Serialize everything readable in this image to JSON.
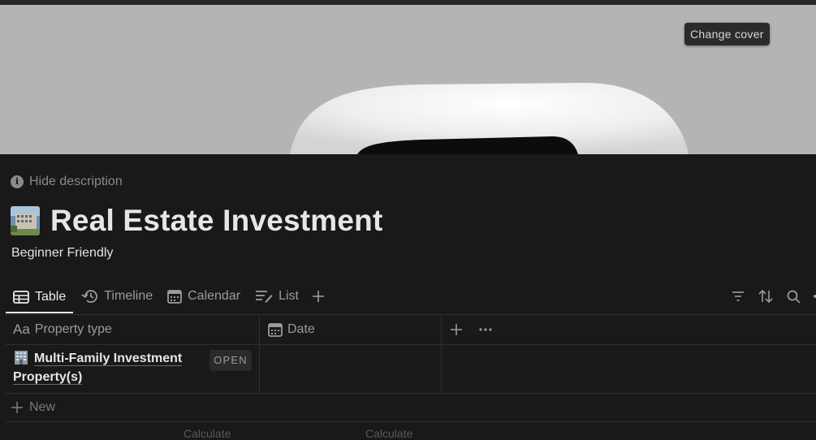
{
  "cover": {
    "change_cover_label": "Change cover"
  },
  "description_toggle": {
    "label": "Hide description",
    "icon": "info-icon"
  },
  "page": {
    "title": "Real Estate Investment",
    "subtitle": "Beginner Friendly",
    "icon": "building-photo-icon"
  },
  "views": {
    "tabs": [
      {
        "label": "Table",
        "icon": "table-icon",
        "active": true
      },
      {
        "label": "Timeline",
        "icon": "timeline-icon",
        "active": false
      },
      {
        "label": "Calendar",
        "icon": "calendar-icon",
        "active": false
      },
      {
        "label": "List",
        "icon": "list-icon",
        "active": false
      }
    ],
    "add_icon": "plus-icon",
    "tools": [
      "filter-icon",
      "sort-icon",
      "search-icon"
    ]
  },
  "table": {
    "columns": [
      {
        "label": "Property type",
        "icon": "Aa"
      },
      {
        "label": "Date",
        "icon": "calendar-icon"
      }
    ],
    "rows": [
      {
        "name": "Multi-Family Investment Property(s)",
        "icon": "office-building-emoji",
        "open_label": "OPEN",
        "date": ""
      }
    ],
    "new_label": "New",
    "calculate_labels": [
      "Calculate",
      "Calculate"
    ]
  },
  "colors": {
    "background": "#191919",
    "cover": "#b4b4b4",
    "text": "#e6e6e6",
    "muted": "#9b9b9b"
  }
}
